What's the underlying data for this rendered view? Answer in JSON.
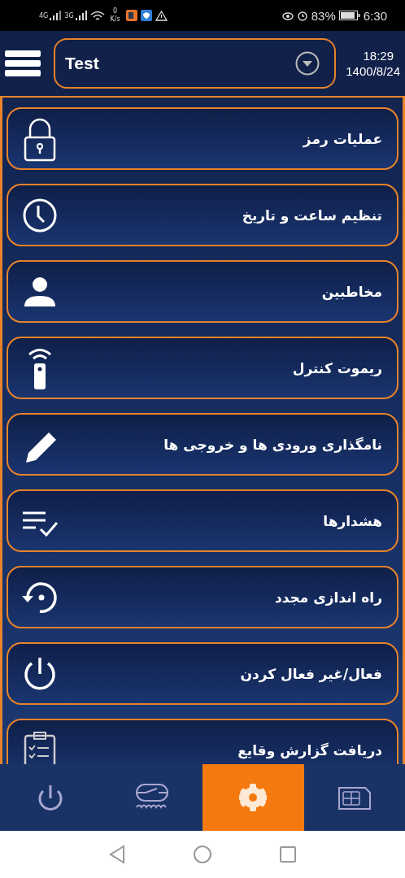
{
  "status_bar": {
    "network_1": "4G",
    "network_2": "3G",
    "speed_value": "0",
    "speed_unit": "K/s",
    "battery": "83%",
    "time": "6:30"
  },
  "header": {
    "device": "Test",
    "time": "18:29",
    "date": "1400/8/24"
  },
  "menu": [
    {
      "label": "عملیات رمز",
      "kind": "lock"
    },
    {
      "label": "تنظیم ساعت و تاریخ",
      "kind": "clock"
    },
    {
      "label": "مخاطبین",
      "kind": "person"
    },
    {
      "label": "ریموت کنترل",
      "kind": "remote"
    },
    {
      "label": "نامگذاری ورودی ها و خروجی ها",
      "kind": "pencil"
    },
    {
      "label": "هشدارها",
      "kind": "checklist"
    },
    {
      "label": "راه اندازی مجدد",
      "kind": "restart"
    },
    {
      "label": "فعال/غیر فعال کردن",
      "kind": "power"
    },
    {
      "label": "دریافت گزارش وقایع",
      "kind": "clipboard"
    }
  ],
  "bottom_nav": [
    {
      "kind": "power",
      "selected": false
    },
    {
      "kind": "switch",
      "selected": false
    },
    {
      "kind": "gear",
      "selected": true
    },
    {
      "kind": "sim",
      "selected": false
    }
  ]
}
